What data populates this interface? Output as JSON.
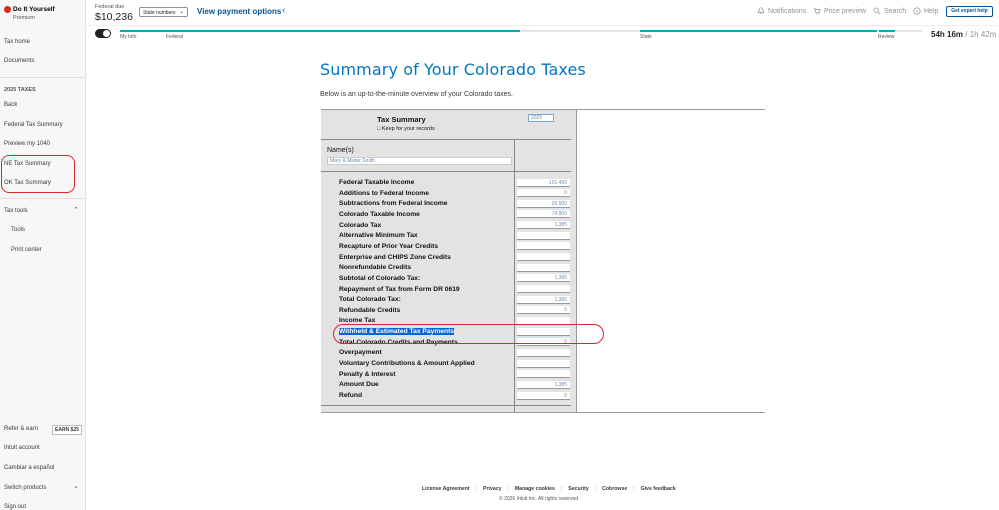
{
  "brand": {
    "name": "Do It Yourself",
    "tier": "Premium"
  },
  "sidebar": {
    "tax_home": "Tax home",
    "documents": "Documents",
    "section_heading": "2025 TAXES",
    "back": "Back",
    "federal_summary": "Federal Tax Summary",
    "preview_1040": "Preview my 1040",
    "ne_summary": "NE Tax Summary",
    "ok_summary": "OK Tax Summary",
    "tax_tools": "Tax tools",
    "tools": "Tools",
    "print_center": "Print center",
    "refer_earn": "Refer & earn",
    "earn_badge": "EARN $25",
    "intuit_account": "Intuit account",
    "espanol": "Cambiar a español",
    "switch_products": "Switch products",
    "sign_out": "Sign out"
  },
  "header": {
    "federal_due_label": "Federal due",
    "federal_due_amount": "$10,236",
    "state_select": "State numbers",
    "view_payment": "View payment options",
    "notifications": "Notifications",
    "price_preview": "Price preview",
    "search": "Search",
    "help": "Help",
    "expert_help": "Get expert help"
  },
  "progress": {
    "steps": [
      "My Info",
      "Federal",
      "State",
      "Review"
    ],
    "timer_main": "54h 16m",
    "timer_sep": "/",
    "timer_total": "1h 42m"
  },
  "main": {
    "title": "Summary of Your Colorado Taxes",
    "intro": "Below is an up-to-the-minute overview of your Colorado taxes."
  },
  "form": {
    "title": "Tax Summary",
    "subtitle": "Keep for your records",
    "year": "2025",
    "names_label": "Name(s)",
    "names_value": "Mary & Mister Smith",
    "lines": [
      {
        "label": "Federal Taxable Income",
        "value": "101,400"
      },
      {
        "label": "Additions to Federal Income",
        "value": "0"
      },
      {
        "label": "Subtractions from Federal Income",
        "value": "26,500"
      },
      {
        "label": "Colorado Taxable Income",
        "value": "74,900"
      },
      {
        "label": "Colorado Tax",
        "value": "1,385"
      },
      {
        "label": "Alternative Minimum Tax",
        "value": ""
      },
      {
        "label": "Recapture of Prior Year Credits",
        "value": ""
      },
      {
        "label": "Enterprise and CHIPS Zone Credits",
        "value": ""
      },
      {
        "label": "Nonrefundable Credits",
        "value": ""
      },
      {
        "label": "Subtotal of Colorado Tax:",
        "value": "1,385"
      },
      {
        "label": "Repayment of Tax from Form DR 0619",
        "value": ""
      },
      {
        "label": "Total Colorado Tax:",
        "value": "1,385"
      },
      {
        "label": "Refundable Credits",
        "value": "0"
      },
      {
        "label": "Income Tax",
        "value": ""
      },
      {
        "label": "Withheld & Estimated Tax Payments",
        "value": ""
      },
      {
        "label": "Total Colorado Credits and Payments",
        "value": "0"
      },
      {
        "label": "Overpayment",
        "value": ""
      },
      {
        "label": "Voluntary Contributions & Amount Applied",
        "value": ""
      },
      {
        "label": "Penalty & Interest",
        "value": ""
      },
      {
        "label": "Amount Due",
        "value": "1,385"
      },
      {
        "label": "Refund",
        "value": "0"
      }
    ]
  },
  "footer": {
    "links": [
      "License Agreement",
      "Privacy",
      "Manage cookies",
      "Security",
      "Cobrowse",
      "Give feedback"
    ],
    "copyright": "© 2026 Intuit Inc. All rights reserved."
  },
  "colors": {
    "accent": "#0077c5",
    "link": "#055393",
    "progress": "#00b1b0",
    "annotation": "#d9252c",
    "highlight": "#0b63d1"
  }
}
